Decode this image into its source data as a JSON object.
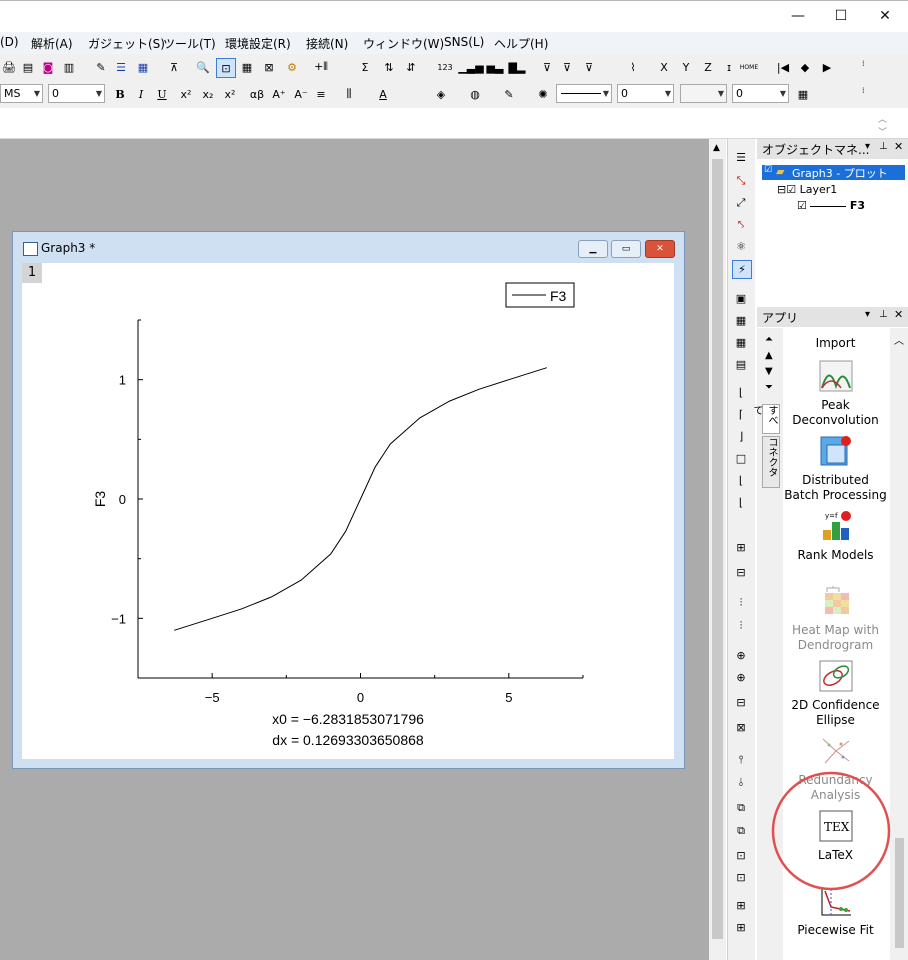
{
  "window": {
    "minimize_label": "—",
    "maximize_label": "☐",
    "close_label": "✕"
  },
  "menu": [
    "(D)",
    "解析(A)",
    "ガジェット(S)",
    "ツール(T)",
    "環境設定(R)",
    "接続(N)",
    "ウィンドウ(W)",
    "SNS(L)",
    "ヘルプ(H)"
  ],
  "format_bar": {
    "font_value": "MS",
    "size_value": "0",
    "bold": "B",
    "italic": "I",
    "underline": "U",
    "greek": "αβ",
    "line_value": "0",
    "pattern_value": "0"
  },
  "object_manager": {
    "title": "オブジェクトマネ...",
    "graph_node": "Graph3 - プロット",
    "layer_node": "Layer1",
    "plot_node": "F3"
  },
  "apps_panel": {
    "title": "アプリ",
    "side_tabs": [
      "すべて",
      "コネクタ"
    ],
    "items": [
      {
        "label": "Import"
      },
      {
        "label": "Peak Deconvolution"
      },
      {
        "label": "Distributed Batch Processing"
      },
      {
        "label": "Rank Models"
      },
      {
        "label": "Heat Map with Dendrogram"
      },
      {
        "label": "2D Confidence Ellipse"
      },
      {
        "label": "Redundancy Analysis"
      },
      {
        "label": "LaTeX"
      },
      {
        "label": "Piecewise Fit"
      }
    ]
  },
  "graph": {
    "window_title": "Graph3 *",
    "layer_number": "1",
    "legend_label": "F3",
    "ylabel": "F3",
    "x_ticks": [
      "−5",
      "0",
      "5"
    ],
    "y_ticks": [
      "1",
      "0",
      "−1"
    ],
    "x0_text": "x0 = −6.2831853071796",
    "dx_text": "dx = 0.12693303650868"
  },
  "chart_data": {
    "type": "line",
    "title": "",
    "xlabel": "",
    "ylabel": "F3",
    "xlim": [
      -7.5,
      7.5
    ],
    "ylim": [
      -1.5,
      1.5
    ],
    "x_ticks": [
      -5,
      0,
      5
    ],
    "y_ticks": [
      -1,
      0,
      1
    ],
    "legend": "top-right",
    "series": [
      {
        "name": "F3",
        "x_start": -6.2831853071796,
        "dx": 0.12693303650868,
        "points": 100,
        "x": [
          -6.28,
          -5,
          -4,
          -3,
          -2,
          -1,
          -0.5,
          0,
          0.5,
          1,
          2,
          3,
          4,
          5,
          6.28
        ],
        "y": [
          -1.1,
          -1.0,
          -0.92,
          -0.82,
          -0.68,
          -0.46,
          -0.27,
          0.0,
          0.27,
          0.46,
          0.68,
          0.82,
          0.92,
          1.0,
          1.1
        ]
      }
    ]
  },
  "highlight_color": "#e05050"
}
